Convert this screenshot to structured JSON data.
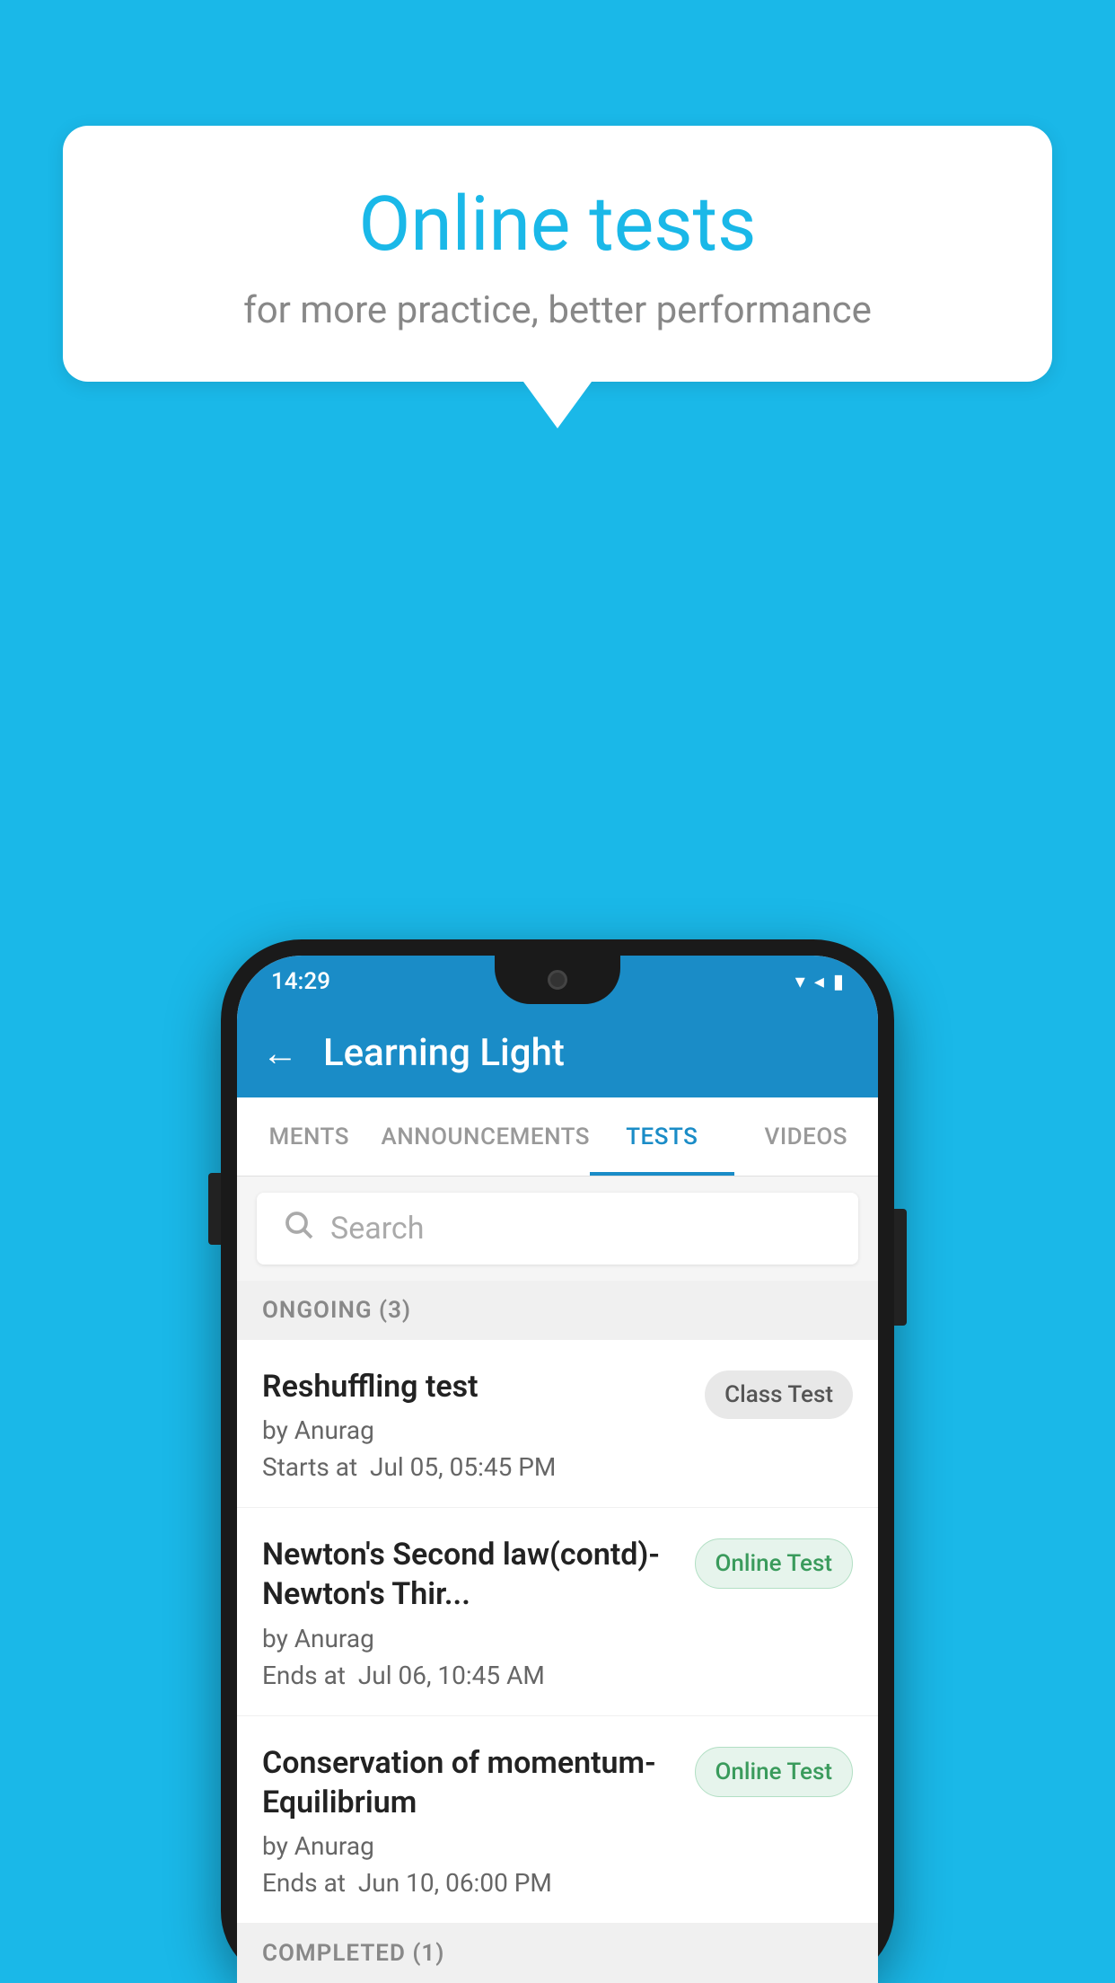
{
  "background": {
    "color": "#1ab8e8"
  },
  "speech_bubble": {
    "title": "Online tests",
    "subtitle": "for more practice, better performance"
  },
  "phone": {
    "status_bar": {
      "time": "14:29",
      "wifi_icon": "▼",
      "signal_icon": "◄",
      "battery_icon": "▮"
    },
    "app_bar": {
      "back_label": "←",
      "title": "Learning Light"
    },
    "tabs": [
      {
        "label": "MENTS",
        "active": false
      },
      {
        "label": "ANNOUNCEMENTS",
        "active": false
      },
      {
        "label": "TESTS",
        "active": true
      },
      {
        "label": "VIDEOS",
        "active": false
      }
    ],
    "search": {
      "placeholder": "Search"
    },
    "ongoing_section": {
      "label": "ONGOING (3)"
    },
    "tests": [
      {
        "title": "Reshuffling test",
        "author": "by Anurag",
        "date_label": "Starts at",
        "date": "Jul 05, 05:45 PM",
        "badge": "Class Test",
        "badge_type": "class"
      },
      {
        "title": "Newton's Second law(contd)-Newton's Thir...",
        "author": "by Anurag",
        "date_label": "Ends at",
        "date": "Jul 06, 10:45 AM",
        "badge": "Online Test",
        "badge_type": "online"
      },
      {
        "title": "Conservation of momentum-Equilibrium",
        "author": "by Anurag",
        "date_label": "Ends at",
        "date": "Jun 10, 06:00 PM",
        "badge": "Online Test",
        "badge_type": "online"
      }
    ],
    "completed_section": {
      "label": "COMPLETED (1)"
    }
  }
}
